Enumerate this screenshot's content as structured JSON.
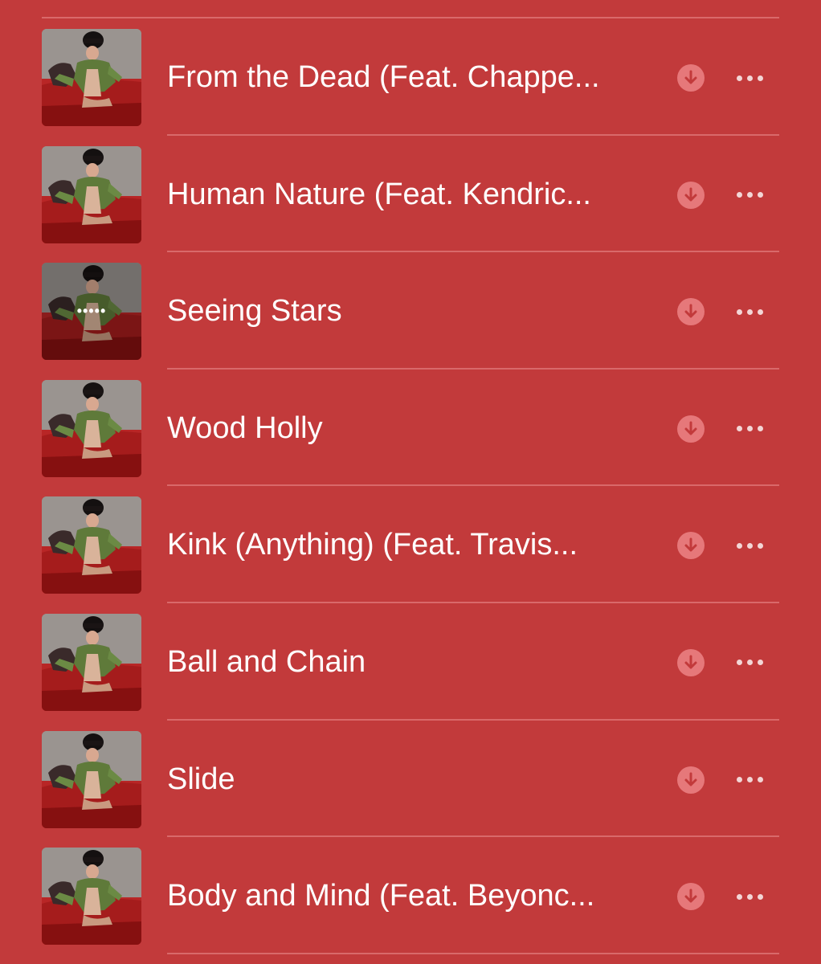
{
  "tracks": [
    {
      "title": "From the Dead (Feat. Chappe...",
      "playing": false
    },
    {
      "title": "Human Nature (Feat. Kendric...",
      "playing": false
    },
    {
      "title": "Seeing Stars",
      "playing": true
    },
    {
      "title": "Wood Holly",
      "playing": false
    },
    {
      "title": "Kink (Anything) (Feat. Travis...",
      "playing": false
    },
    {
      "title": "Ball and Chain",
      "playing": false
    },
    {
      "title": "Slide",
      "playing": false
    },
    {
      "title": "Body and Mind (Feat. Beyonc...",
      "playing": false
    }
  ],
  "icons": {
    "download": "arrow-down-circle-icon",
    "more": "ellipsis-icon",
    "playing": "now-playing-icon"
  },
  "colors": {
    "background": "#c23a3b",
    "divider": "#d9696a",
    "download_circle": "#e6787a",
    "text": "#ffffff"
  },
  "playing_indicator": "•••••"
}
